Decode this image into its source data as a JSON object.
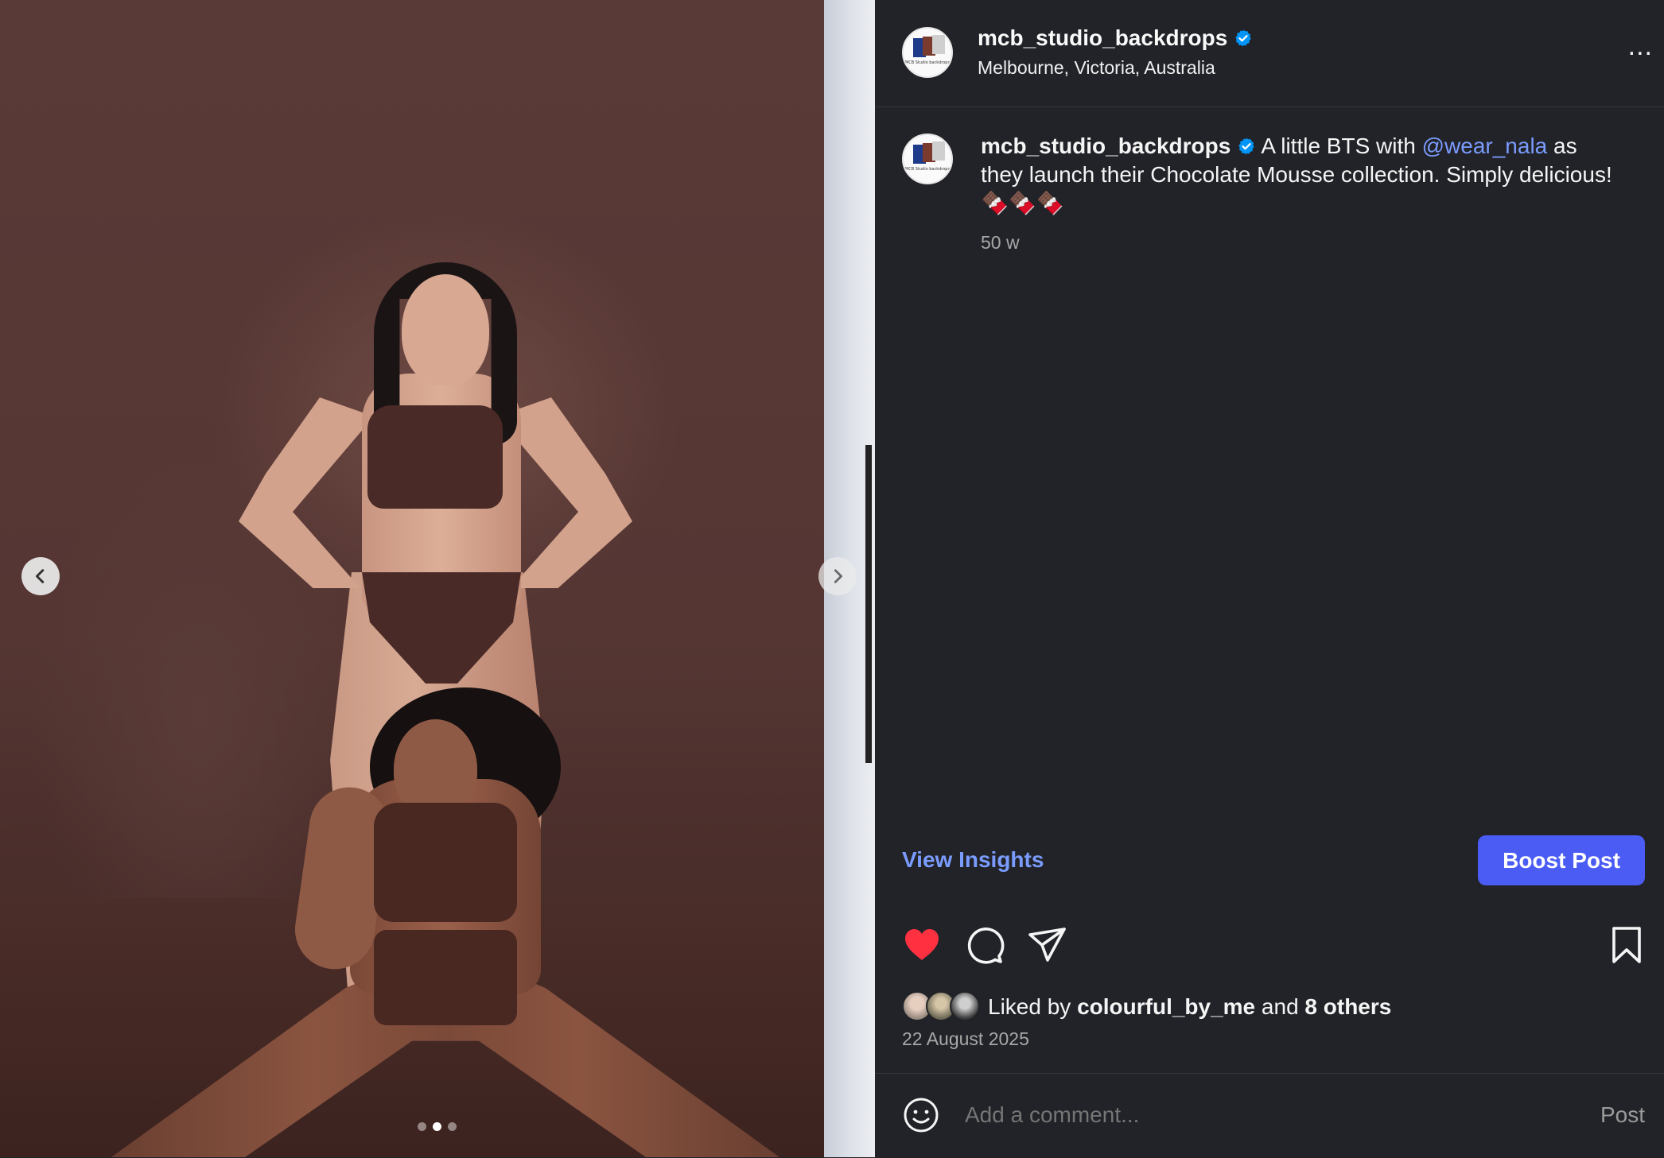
{
  "post": {
    "username": "mcb_studio_backdrops",
    "location": "Melbourne, Victoria, Australia",
    "avatar_text": "MCB Studio backdrops",
    "caption": {
      "username": "mcb_studio_backdrops",
      "text_before": " A little BTS with ",
      "mention": "@wear_nala",
      "text_after": " as they launch their Chocolate Mousse collection. Simply delicious! ",
      "emojis": "🍫🍫🍫"
    },
    "time_ago": "50 w",
    "view_insights_label": "View Insights",
    "boost_label": "Boost Post",
    "liked": true,
    "likes": {
      "prefix": "Liked by ",
      "user": "colourful_by_me",
      "middle": " and ",
      "others": "8 others"
    },
    "date": "22 August 2025",
    "comment_placeholder": "Add a comment...",
    "post_label": "Post",
    "more_label": "..."
  },
  "carousel": {
    "prev_label": "‹",
    "next_label": "›",
    "slide_count": 3,
    "active_slide": 2
  },
  "colors": {
    "background": "#212328",
    "accent": "#4b5cf5",
    "link": "#7b9cff",
    "like": "#ff3040",
    "verified": "#0095f6"
  },
  "icons": [
    "heart-icon",
    "comment-icon",
    "share-icon",
    "bookmark-icon",
    "verified-icon",
    "emoji-icon",
    "more-icon",
    "chevron-left-icon",
    "chevron-right-icon"
  ]
}
